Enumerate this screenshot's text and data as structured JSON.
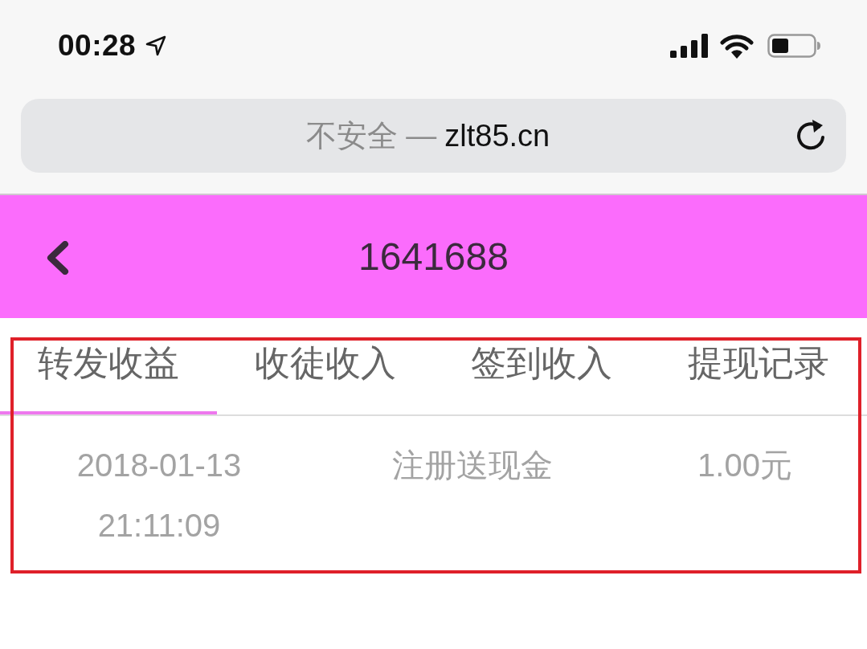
{
  "status_bar": {
    "time": "00:28"
  },
  "address_bar": {
    "security_label": "不安全 —",
    "domain": "zlt85.cn"
  },
  "header": {
    "title": "1641688"
  },
  "tabs": [
    {
      "label": "转发收益",
      "selected": true
    },
    {
      "label": "收徒收入",
      "selected": false
    },
    {
      "label": "签到收入",
      "selected": false
    },
    {
      "label": "提现记录",
      "selected": false
    }
  ],
  "records": [
    {
      "time": "2018-01-13 21:11:09",
      "description": "注册送现金",
      "amount": "1.00元"
    }
  ],
  "annotations": [
    {
      "kind": "box"
    }
  ]
}
